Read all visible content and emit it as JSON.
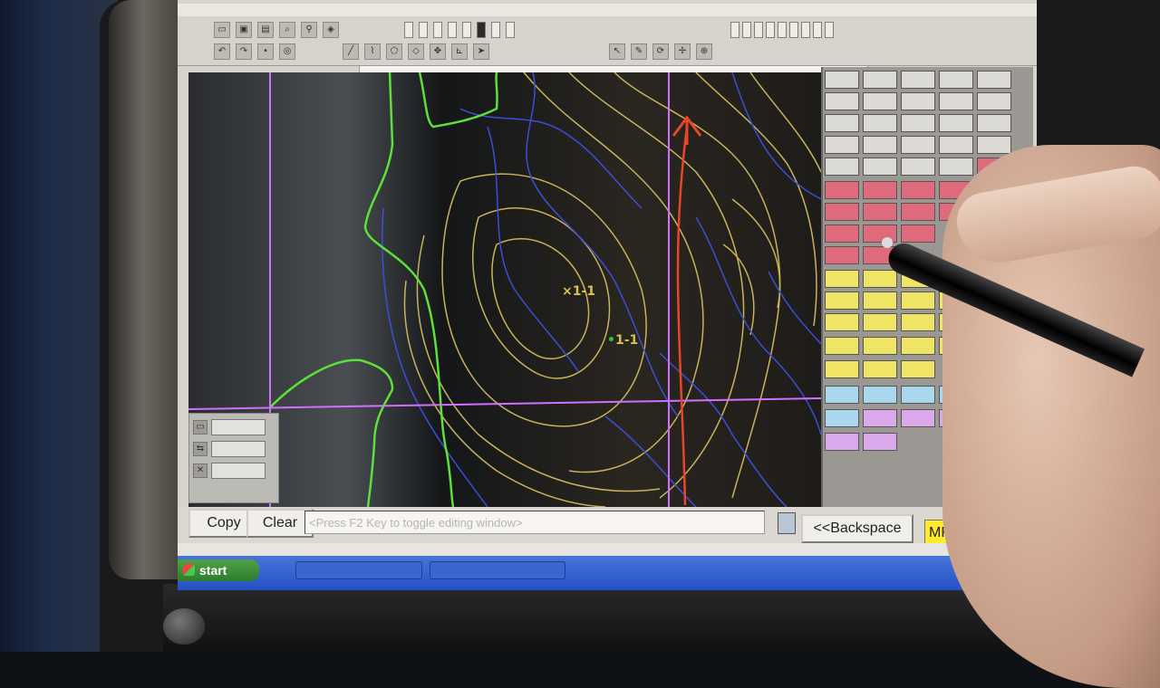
{
  "toolbar": {
    "buttons": [
      "",
      "",
      "",
      "",
      "",
      "",
      "",
      ""
    ],
    "right_buttons": [
      "",
      "",
      "",
      "",
      "",
      "",
      "",
      "",
      ""
    ]
  },
  "map": {
    "waypoints": [
      {
        "label": "1-1",
        "marker": "×",
        "color": "#d6c24a"
      },
      {
        "label": "1-1",
        "marker": "•",
        "color": "#2ec43a"
      }
    ],
    "panel_buttons": [
      "",
      "",
      ""
    ]
  },
  "keypad": {
    "colors": {
      "gray": "#dcdad4",
      "pink": "#df6a7c",
      "yellow": "#f0e464",
      "blue": "#a9d8ee",
      "violet": "#dca8ec"
    }
  },
  "command_bar": {
    "copy_label": "Copy",
    "clear_label": "Clear",
    "input_placeholder": "<Press F2 Key to toggle editing window>",
    "backspace_label": "<<Backspace",
    "mode_value": "MPoint"
  },
  "taskbar": {
    "start_label": "start",
    "tasks": [
      "",
      ""
    ]
  },
  "colors": {
    "boundary_green": "#5ee03a",
    "stream_blue": "#3a4fd6",
    "contour_tan": "#c9b35a",
    "grid_magenta": "#d070ff",
    "track_red": "#e8462a",
    "taskbar_blue": "#2452c4",
    "start_green": "#3a8f37",
    "mode_yellow": "#ffeb2a"
  }
}
